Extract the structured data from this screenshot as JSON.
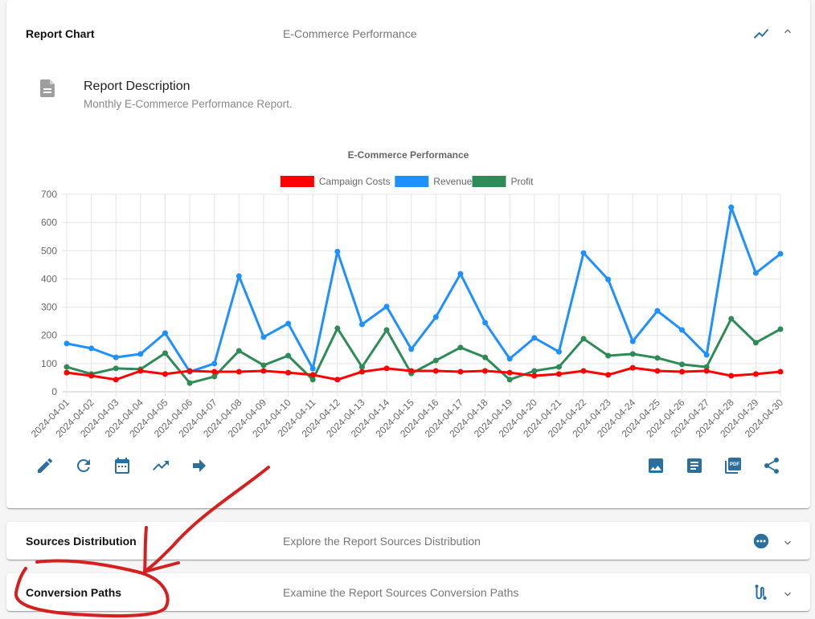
{
  "report_chart": {
    "title": "Report Chart",
    "subtitle": "E-Commerce Performance",
    "header_icon": "show-chart-icon",
    "toggle_icon": "chevron-up-icon",
    "description": {
      "icon": "document-icon",
      "title": "Report Description",
      "text": "Monthly E-Commerce Performance Report."
    },
    "toolbar_left": [
      {
        "name": "edit-icon",
        "label": "Edit"
      },
      {
        "name": "refresh-icon",
        "label": "Refresh"
      },
      {
        "name": "calendar-icon",
        "label": "Date range"
      },
      {
        "name": "trending-up-icon",
        "label": "Trend"
      },
      {
        "name": "arrow-right-icon",
        "label": "Forward"
      }
    ],
    "toolbar_right": [
      {
        "name": "image-icon",
        "label": "Export image"
      },
      {
        "name": "article-icon",
        "label": "Export document"
      },
      {
        "name": "pdf-icon",
        "label": "Export PDF"
      },
      {
        "name": "share-icon",
        "label": "Share"
      }
    ]
  },
  "sections": [
    {
      "title": "Sources Distribution",
      "subtitle": "Explore the Report Sources Distribution",
      "icon": "more-horizontal-circle-icon",
      "toggle_icon": "chevron-down-icon"
    },
    {
      "title": "Conversion Paths",
      "subtitle": "Examine the Report Sources Conversion Paths",
      "icon": "route-icon",
      "toggle_icon": "chevron-down-icon"
    }
  ],
  "colors": {
    "accent": "#2a6f9e",
    "campaign_costs": "#ff0000",
    "revenue": "#1e90ff",
    "profit": "#2e8b57",
    "annotation": "#d42020"
  },
  "chart_data": {
    "type": "line",
    "title": "E-Commerce Performance",
    "xlabel": "",
    "ylabel": "",
    "ylim": [
      0,
      700
    ],
    "yticks": [
      0,
      100,
      200,
      300,
      400,
      500,
      600,
      700
    ],
    "grid": true,
    "legend_position": "top",
    "x": [
      "2024-04-01",
      "2024-04-02",
      "2024-04-03",
      "2024-04-04",
      "2024-04-05",
      "2024-04-06",
      "2024-04-07",
      "2024-04-08",
      "2024-04-09",
      "2024-04-10",
      "2024-04-11",
      "2024-04-12",
      "2024-04-13",
      "2024-04-14",
      "2024-04-15",
      "2024-04-16",
      "2024-04-17",
      "2024-04-18",
      "2024-04-19",
      "2024-04-20",
      "2024-04-21",
      "2024-04-22",
      "2024-04-23",
      "2024-04-24",
      "2024-04-25",
      "2024-04-26",
      "2024-04-27",
      "2024-04-28",
      "2024-04-29",
      "2024-04-30"
    ],
    "series": [
      {
        "name": "Campaign Costs",
        "color": "#ff0000",
        "values": [
          68,
          57,
          43,
          74,
          63,
          74,
          71,
          71,
          74,
          68,
          60,
          43,
          71,
          83,
          74,
          74,
          71,
          74,
          68,
          57,
          63,
          74,
          60,
          85,
          74,
          71,
          74,
          57,
          63,
          71
        ]
      },
      {
        "name": "Revenue",
        "color": "#1e90ff",
        "values": [
          171,
          154,
          122,
          134,
          208,
          71,
          100,
          410,
          194,
          242,
          82,
          497,
          239,
          302,
          151,
          265,
          418,
          245,
          117,
          191,
          142,
          492,
          398,
          179,
          287,
          219,
          131,
          654,
          421,
          489
        ]
      },
      {
        "name": "Profit",
        "color": "#2e8b57",
        "values": [
          88,
          63,
          83,
          80,
          137,
          31,
          54,
          145,
          94,
          128,
          43,
          225,
          88,
          219,
          65,
          111,
          157,
          122,
          43,
          74,
          88,
          188,
          128,
          134,
          120,
          97,
          88,
          259,
          174,
          222
        ]
      }
    ]
  },
  "annotation": {
    "type": "hand-drawn arrow and circle",
    "target": "Conversion Paths"
  }
}
